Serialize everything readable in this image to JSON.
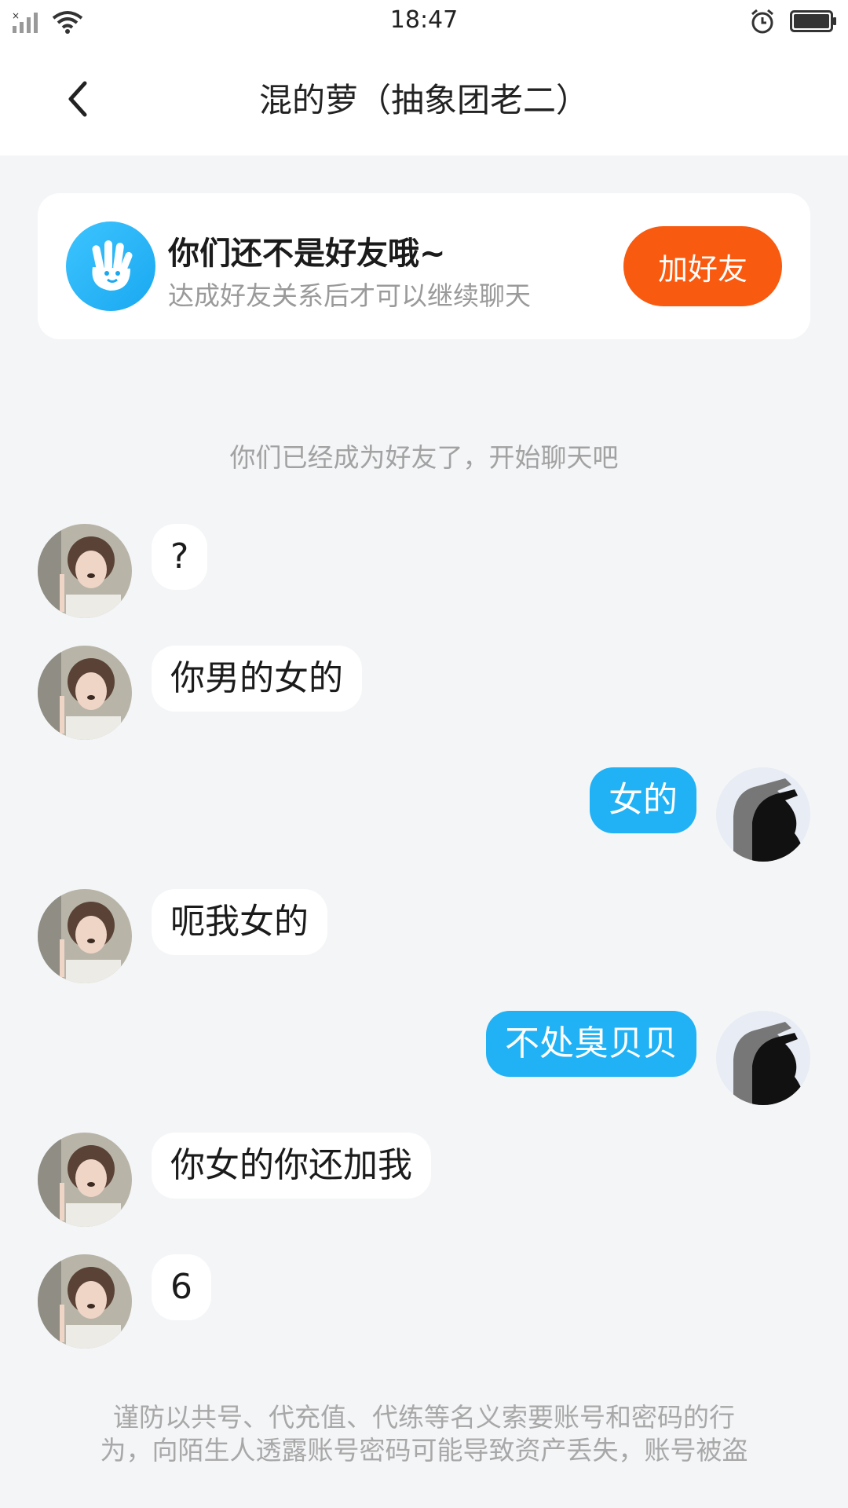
{
  "status_bar": {
    "time": "18:47",
    "icons": [
      "signal-icon",
      "wifi-icon",
      "alarm-icon",
      "battery-icon"
    ]
  },
  "header": {
    "title": "混的萝（抽象团老二）",
    "back_icon": "chevron-left-icon"
  },
  "friend_card": {
    "icon": "hand-wave-icon",
    "title": "你们还不是好友哦~",
    "subtitle": "达成好友关系后才可以继续聊天",
    "button_label": "加好友"
  },
  "system_message": "你们已经成为好友了，开始聊天吧",
  "messages": [
    {
      "side": "left",
      "text": "?"
    },
    {
      "side": "left",
      "text": "你男的女的"
    },
    {
      "side": "right",
      "text": "女的"
    },
    {
      "side": "left",
      "text": "呃我女的"
    },
    {
      "side": "right",
      "text": "不处臭贝贝"
    },
    {
      "side": "left",
      "text": "你女的你还加我"
    },
    {
      "side": "left",
      "text": "6"
    }
  ],
  "footer_warning": {
    "line1": "谨防以共号、代充值、代练等名义索要账号和密码的行",
    "line2": "为，向陌生人透露账号密码可能导致资产丢失，账号被盗"
  },
  "colors": {
    "background": "#f4f5f7",
    "accent_orange": "#f85a10",
    "bubble_blue": "#20b2f5",
    "icon_blue": "#2ab6f8"
  }
}
